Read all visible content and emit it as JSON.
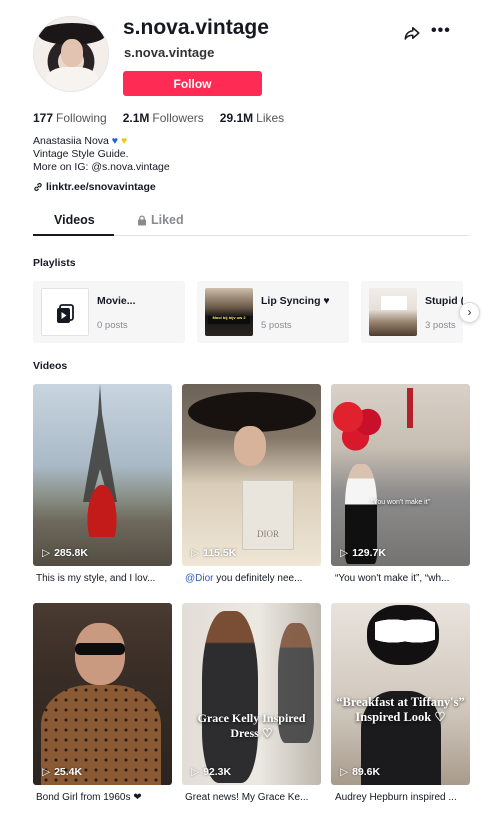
{
  "profile": {
    "title": "s.nova.vintage",
    "subtitle": "s.nova.vintage",
    "follow_label": "Follow",
    "share_icon": "share-arrow-icon",
    "more_icon": "more-dots-icon"
  },
  "stats": [
    {
      "value": "177",
      "label": "Following"
    },
    {
      "value": "2.1M",
      "label": "Followers"
    },
    {
      "value": "29.1M",
      "label": "Likes"
    }
  ],
  "bio": {
    "name_line": "Anastasiia Nova",
    "line2": "Vintage Style Guide.",
    "line3": "More on IG: @s.nova.vintage",
    "link": "linktr.ee/snovavintage"
  },
  "tabs": {
    "videos": "Videos",
    "liked": "Liked"
  },
  "playlists_label": "Playlists",
  "playlists": [
    {
      "title": "Movie...",
      "count": "0 posts"
    },
    {
      "title": "Lip Syncing ♥",
      "count": "5 posts"
    },
    {
      "title": "Stupid (",
      "count": "3 posts"
    }
  ],
  "videos_label": "Videos",
  "videos": [
    {
      "views": "285.8K",
      "caption": "This is my style, and I lov...",
      "overlay": ""
    },
    {
      "views": "115.5K",
      "caption_mention": "@Dior",
      "caption": " you definitely nee...",
      "overlay": ""
    },
    {
      "views": "129.7K",
      "caption": "“You won't make it”, “wh...",
      "overlay": "“You won't make it”"
    },
    {
      "views": "25.4K",
      "caption": "Bond Girl from 1960s ❤",
      "overlay": ""
    },
    {
      "views": "92.3K",
      "caption": "Great news! My Grace Ke...",
      "overlay": "Grace Kelly Inspired Dress ♡"
    },
    {
      "views": "89.6K",
      "caption": "Audrey Hepburn inspired ...",
      "overlay": "“Breakfast at Tiffany's” Inspired Look ♡"
    }
  ],
  "colors": {
    "accent": "#fe2c55",
    "mention": "#2b5db8"
  }
}
